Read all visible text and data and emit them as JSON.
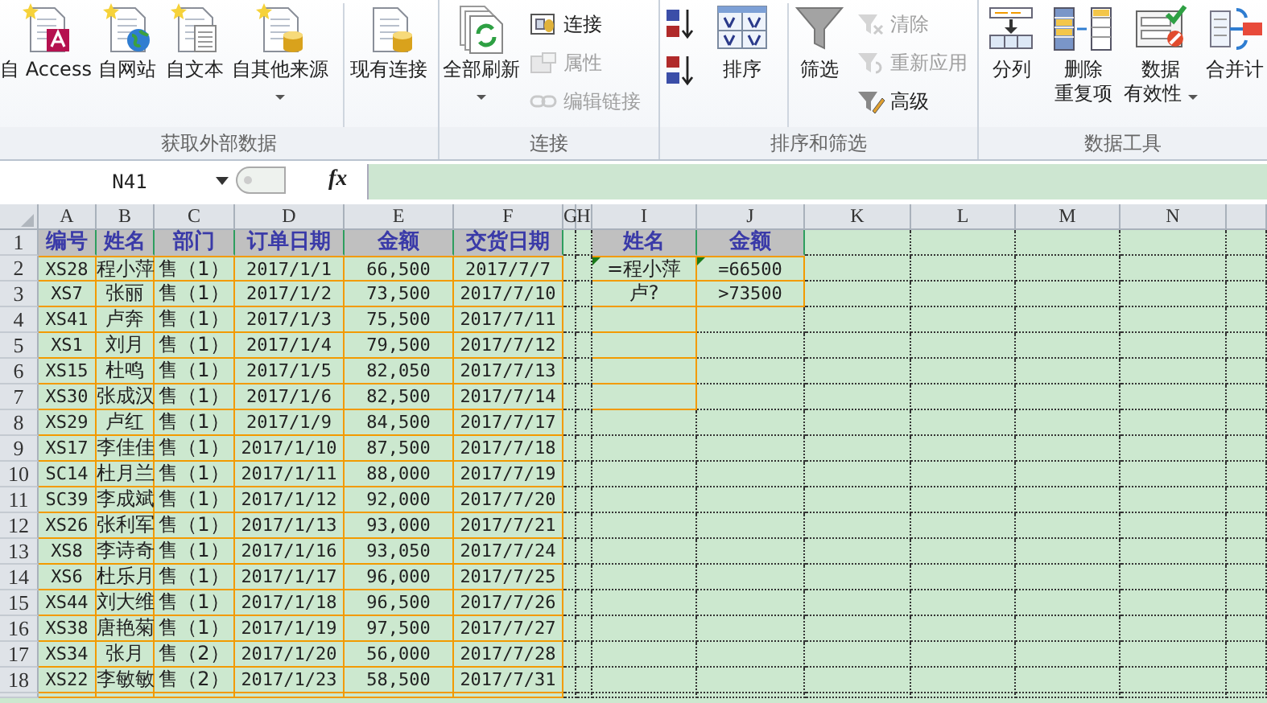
{
  "ribbon": {
    "groups": [
      {
        "label": "获取外部数据",
        "items": [
          {
            "kind": "large",
            "lines": [
              "自 Access"
            ],
            "dropdown": false,
            "separator_before": false
          },
          {
            "kind": "large",
            "lines": [
              "自网站"
            ],
            "dropdown": false,
            "separator_before": false
          },
          {
            "kind": "large",
            "lines": [
              "自文本"
            ],
            "dropdown": false,
            "separator_before": false
          },
          {
            "kind": "large",
            "lines": [
              "自其他来源"
            ],
            "dropdown": true,
            "separator_before": false
          },
          {
            "kind": "large",
            "lines": [
              "现有连接"
            ],
            "dropdown": false,
            "separator_before": true
          }
        ]
      },
      {
        "label": "连接",
        "items": [
          {
            "kind": "large",
            "lines": [
              "全部刷新"
            ],
            "dropdown": true,
            "separator_before": false
          },
          {
            "kind": "stack",
            "separator_before": false,
            "items": [
              {
                "label": "连接",
                "disabled": false
              },
              {
                "label": "属性",
                "disabled": true
              },
              {
                "label": "编辑链接",
                "disabled": true
              }
            ]
          }
        ]
      },
      {
        "label": "排序和筛选",
        "items": [
          {
            "kind": "stack",
            "separator_before": false,
            "items": [
              {
                "disabled": false
              },
              {
                "disabled": false
              }
            ]
          },
          {
            "kind": "large",
            "lines": [
              "排序"
            ],
            "dropdown": false,
            "separator_before": false
          },
          {
            "kind": "large",
            "lines": [
              "筛选"
            ],
            "dropdown": false,
            "separator_before": true
          },
          {
            "kind": "stack",
            "separator_before": false,
            "items": [
              {
                "label": "清除",
                "disabled": true
              },
              {
                "label": "重新应用",
                "disabled": true
              },
              {
                "label": "高级",
                "disabled": false
              }
            ]
          }
        ]
      },
      {
        "label": "数据工具",
        "items": [
          {
            "kind": "large",
            "lines": [
              "分列"
            ],
            "dropdown": false,
            "separator_before": false
          },
          {
            "kind": "large",
            "lines": [
              "删除",
              "重复项"
            ],
            "dropdown": false,
            "separator_before": false
          },
          {
            "kind": "large",
            "lines": [
              "数据",
              "有效性"
            ],
            "dropdown": true,
            "separator_before": false
          },
          {
            "kind": "large",
            "lines": [
              "合并计"
            ],
            "dropdown": false,
            "separator_before": false
          }
        ]
      }
    ]
  },
  "formula_bar": {
    "name_box": "N41",
    "function_label": "fx"
  },
  "sheet": {
    "columns": [
      "A",
      "B",
      "C",
      "D",
      "E",
      "F",
      "G",
      "H",
      "I",
      "J",
      "K",
      "L",
      "M",
      "N"
    ],
    "row_numbers": [
      "1",
      "2",
      "3",
      "4",
      "5",
      "6",
      "7",
      "8",
      "9",
      "10",
      "11",
      "12",
      "13",
      "14",
      "15",
      "16",
      "17",
      "18"
    ],
    "table": [
      [
        "编号",
        "姓名",
        "部门",
        "订单日期",
        "金额",
        "交货日期"
      ],
      [
        "XS28",
        "程小萍",
        "售（1）",
        "2017/1/1",
        "66,500",
        "2017/7/7"
      ],
      [
        "XS7",
        "张丽",
        "售（1）",
        "2017/1/2",
        "73,500",
        "2017/7/10"
      ],
      [
        "XS41",
        "卢奔",
        "售（1）",
        "2017/1/3",
        "75,500",
        "2017/7/11"
      ],
      [
        "XS1",
        "刘月",
        "售（1）",
        "2017/1/4",
        "79,500",
        "2017/7/12"
      ],
      [
        "XS15",
        "杜鸣",
        "售（1）",
        "2017/1/5",
        "82,050",
        "2017/7/13"
      ],
      [
        "XS30",
        "张成汉",
        "售（1）",
        "2017/1/6",
        "82,500",
        "2017/7/14"
      ],
      [
        "XS29",
        "卢红",
        "售（1）",
        "2017/1/9",
        "84,500",
        "2017/7/17"
      ],
      [
        "XS17",
        "李佳佳",
        "售（1）",
        "2017/1/10",
        "87,500",
        "2017/7/18"
      ],
      [
        "SC14",
        "杜月兰",
        "售（1）",
        "2017/1/11",
        "88,000",
        "2017/7/19"
      ],
      [
        "SC39",
        "李成斌",
        "售（1）",
        "2017/1/12",
        "92,000",
        "2017/7/20"
      ],
      [
        "XS26",
        "张利军",
        "售（1）",
        "2017/1/13",
        "93,000",
        "2017/7/21"
      ],
      [
        "XS8",
        "李诗奇",
        "售（1）",
        "2017/1/16",
        "93,050",
        "2017/7/24"
      ],
      [
        "XS6",
        "杜乐月",
        "售（1）",
        "2017/1/17",
        "96,000",
        "2017/7/25"
      ],
      [
        "XS44",
        "刘大维",
        "售（1）",
        "2017/1/18",
        "96,500",
        "2017/7/26"
      ],
      [
        "XS38",
        "唐艳菊",
        "售（1）",
        "2017/1/19",
        "97,500",
        "2017/7/27"
      ],
      [
        "XS34",
        "张月",
        "售（2）",
        "2017/1/20",
        "56,000",
        "2017/7/28"
      ],
      [
        "XS22",
        "李敏敏",
        "售（2）",
        "2017/1/23",
        "58,500",
        "2017/7/31"
      ]
    ],
    "criteria": {
      "header": [
        "姓名",
        "金额"
      ],
      "rows": [
        [
          {
            "text": "=程小萍",
            "flag": true
          },
          {
            "text": "=66500",
            "flag": true
          }
        ],
        [
          {
            "text": "卢?",
            "flag": false
          },
          {
            "text": ">73500",
            "flag": false
          }
        ]
      ]
    }
  }
}
